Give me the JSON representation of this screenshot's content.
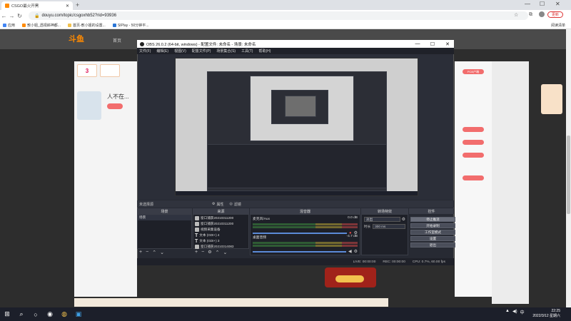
{
  "browser": {
    "tab_title": "CSGO最火开黑",
    "url": "douyu.com/topic/csgoxhb52?rid=93936",
    "bookmarks": [
      "应用",
      "敖小姐_透视斜神都...",
      "首页-敖小姐的设置...",
      "SIPlay - 50分钟平..."
    ],
    "reading_list": "阅读清单",
    "update_label": "更新"
  },
  "site": {
    "logo": "斗鱼",
    "nav_first": "首页",
    "left_badge_value": "3",
    "left_name": "人不在...",
    "right_pill": "PCB户端",
    "right_pill_2": "活动"
  },
  "obs": {
    "title": "OBS 26.0.2 (64-bit, windows) - 配置文件: 未命名 - 场景: 未命名",
    "menu": [
      "文件(F)",
      "编辑(E)",
      "视图(V)",
      "配置文件(P)",
      "场景集合(S)",
      "工具(T)",
      "帮助(H)"
    ],
    "bar_label": "未选择源",
    "bar_props": "属性",
    "bar_filters": "滤镜",
    "docks": {
      "scenes": "场景",
      "sources": "来源",
      "mixer": "混音器",
      "transitions": "转场特效",
      "controls": "控件"
    },
    "scene_item": "场景",
    "sources": [
      "窗口捕获20210311200",
      "窗口捕获20210311200",
      "视频采集设备",
      "文本 (GDI+) 4",
      "文本 (GDI+) 3",
      "窗口捕获20210314083"
    ],
    "mixer": [
      {
        "name": "麦克风/Aux",
        "db": "0.0 dB"
      },
      {
        "name": "桌面音频",
        "db": "-4.7 dB"
      }
    ],
    "transition_type": "淡出",
    "duration_label": "时长",
    "duration_value": "300 ms",
    "controls": [
      "停止推流",
      "开始录制",
      "工作室模式",
      "设置",
      "退出"
    ],
    "status": {
      "live": "LIVE: 00:00:00",
      "rec": "REC: 00:00:00",
      "cpu": "CPU: 0.7%, 60.00 fps"
    }
  },
  "taskbar": {
    "time": "22:25",
    "date": "2022/3/12 星期六",
    "lang": "中"
  },
  "colors": {
    "obs_bg": "#272a33",
    "accent_orange": "#ff8a00",
    "pill_red": "#f26d6d"
  }
}
